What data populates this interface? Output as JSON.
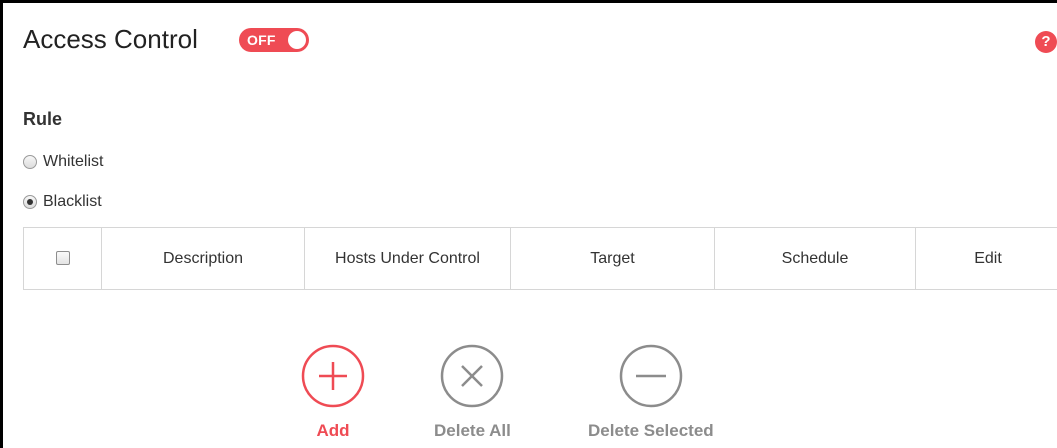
{
  "header": {
    "title": "Access Control",
    "toggle_label": "OFF",
    "help_glyph": "?"
  },
  "rule": {
    "label": "Rule",
    "options": [
      {
        "label": "Whitelist",
        "checked": false
      },
      {
        "label": "Blacklist",
        "checked": true
      }
    ]
  },
  "table": {
    "columns": [
      "",
      "Description",
      "Hosts Under Control",
      "Target",
      "Schedule",
      "Edit"
    ],
    "rows": []
  },
  "actions": {
    "add_label": "Add",
    "delete_all_label": "Delete All",
    "delete_selected_label": "Delete Selected"
  },
  "icons": {
    "add": "plus-circle-icon",
    "delete_all": "x-circle-icon",
    "delete_selected": "minus-circle-icon",
    "help": "question-icon"
  },
  "colors": {
    "accent": "#ef4b54",
    "muted": "#8c8c8c",
    "border": "#d6d6d6"
  }
}
